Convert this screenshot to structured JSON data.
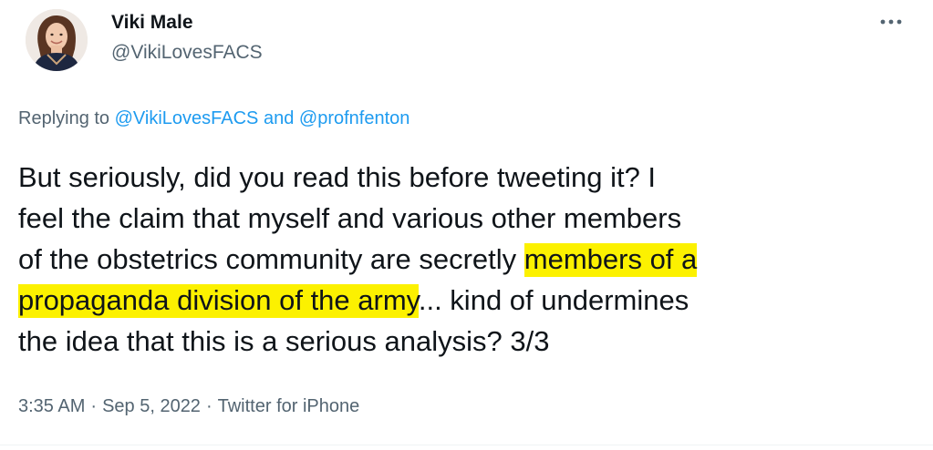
{
  "tweet": {
    "author": {
      "display_name": "Viki Male",
      "handle": "@VikiLovesFACS",
      "avatar_icon": "profile-photo"
    },
    "more_icon": "more-options-icon",
    "reply": {
      "prefix": "Replying to",
      "mention_1": "@VikiLovesFACS",
      "conjunction": "and",
      "mention_2": "@profnfenton"
    },
    "body": {
      "line_1": "But seriously, did you read this before tweeting it? I",
      "line_2": "feel the claim that myself and various other members",
      "line_3_plain": "of the obstetrics community are secretly ",
      "line_3_highlight": "members of a",
      "line_4_highlight": "propaganda division of the army",
      "line_4_plain": "... kind of undermines",
      "line_5": "the idea that this is a serious analysis? 3/3",
      "highlight_color": "#fcf100"
    },
    "meta": {
      "time": "3:35 AM",
      "dot_1": "·",
      "date": "Sep 5, 2022",
      "dot_2": "·",
      "source": "Twitter for iPhone"
    },
    "colors": {
      "text": "#0f1419",
      "secondary": "#536471",
      "link": "#1d9bf0"
    }
  }
}
